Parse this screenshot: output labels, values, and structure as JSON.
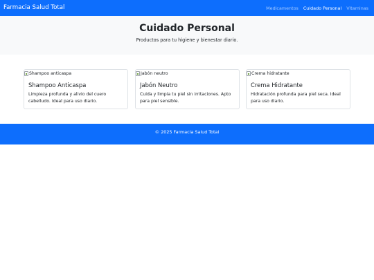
{
  "navbar": {
    "brand": "Farmacia Salud Total",
    "links": [
      {
        "label": "Medicamentos",
        "active": false
      },
      {
        "label": "Cuidado Personal",
        "active": true
      },
      {
        "label": "Vitaminas",
        "active": false
      }
    ]
  },
  "hero": {
    "title": "Cuidado Personal",
    "subtitle": "Productos para tu higiene y bienestar diario."
  },
  "products": [
    {
      "image_alt": "Shampoo anticaspa",
      "title": "Shampoo Anticaspa",
      "description": "Limpieza profunda y alivio del cuero cabelludo. Ideal para uso diario."
    },
    {
      "image_alt": "Jabón neutro",
      "title": "Jabón Neutro",
      "description": "Cuida y limpia tu piel sin irritaciones. Apto para piel sensible."
    },
    {
      "image_alt": "Crema hidratante",
      "title": "Crema Hidratante",
      "description": "Hidratación profunda para piel seca. Ideal para uso diario."
    }
  ],
  "footer": {
    "text": "© 2025 Farmacia Salud Total"
  },
  "colors": {
    "primary": "#0d6efd",
    "hero_background": "#f8f9fa",
    "card_border": "#dee2e6"
  },
  "icons": {
    "product_image": "broken-image-icon"
  }
}
